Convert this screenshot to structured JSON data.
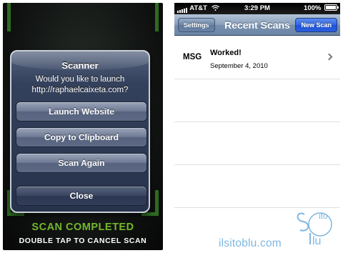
{
  "scanner": {
    "alert": {
      "title": "Scanner",
      "message": "Would you like to launch http://raphaelcaixeta.com?",
      "buttons": [
        "Launch Website",
        "Copy to Clipboard",
        "Scan Again",
        "Close"
      ]
    },
    "status_text": "SCAN COMPLETED",
    "hint_text": "DOUBLE TAP TO CANCEL SCAN",
    "accent_color": "#74b82b"
  },
  "recent": {
    "status_bar": {
      "carrier": "AT&T",
      "time": "3:29 PM",
      "battery": "100%"
    },
    "nav": {
      "title": "Recent Scans",
      "left_button": "Settings",
      "right_button": "New Scan"
    },
    "items": [
      {
        "kind": "MSG",
        "title": "Worked!",
        "date": "September 4, 2010"
      }
    ]
  },
  "watermark": {
    "text": "ilsitoblu.com",
    "logo_letters": "Sito lu"
  }
}
